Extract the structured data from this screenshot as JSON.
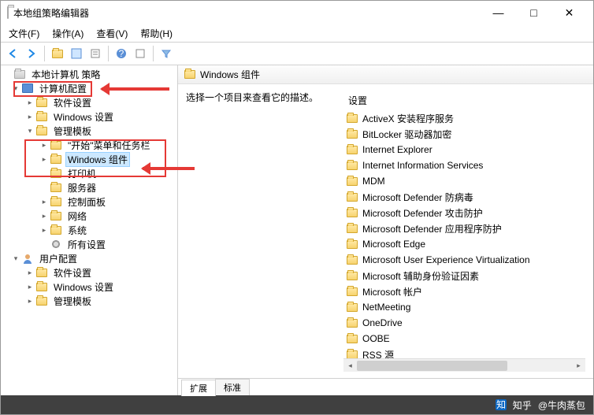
{
  "window": {
    "title": "本地组策略编辑器"
  },
  "menubar": [
    "文件(F)",
    "操作(A)",
    "查看(V)",
    "帮助(H)"
  ],
  "tree": {
    "root": "本地计算机 策略",
    "computer_config": "计算机配置",
    "software_settings": "软件设置",
    "windows_settings": "Windows 设置",
    "admin_templates": "管理模板",
    "start_menu": "\"开始\"菜单和任务栏",
    "windows_components": "Windows 组件",
    "printer": "打印机",
    "server": "服务器",
    "control_panel": "控制面板",
    "network": "网络",
    "system": "系统",
    "all_settings": "所有设置",
    "user_config": "用户配置",
    "u_software_settings": "软件设置",
    "u_windows_settings": "Windows 设置",
    "u_admin_templates": "管理模板"
  },
  "content": {
    "header": "Windows 组件",
    "description": "选择一个项目来查看它的描述。",
    "list_header": "设置",
    "items": [
      "ActiveX 安装程序服务",
      "BitLocker 驱动器加密",
      "Internet Explorer",
      "Internet Information Services",
      "MDM",
      "Microsoft Defender 防病毒",
      "Microsoft Defender 攻击防护",
      "Microsoft Defender 应用程序防护",
      "Microsoft Edge",
      "Microsoft User Experience Virtualization",
      "Microsoft 辅助身份验证因素",
      "Microsoft 帐户",
      "NetMeeting",
      "OneDrive",
      "OOBE",
      "RSS 源"
    ]
  },
  "tabs": {
    "extended": "扩展",
    "standard": "标准"
  },
  "footer": {
    "source": "知乎",
    "author": "@牛肉蒸包"
  }
}
